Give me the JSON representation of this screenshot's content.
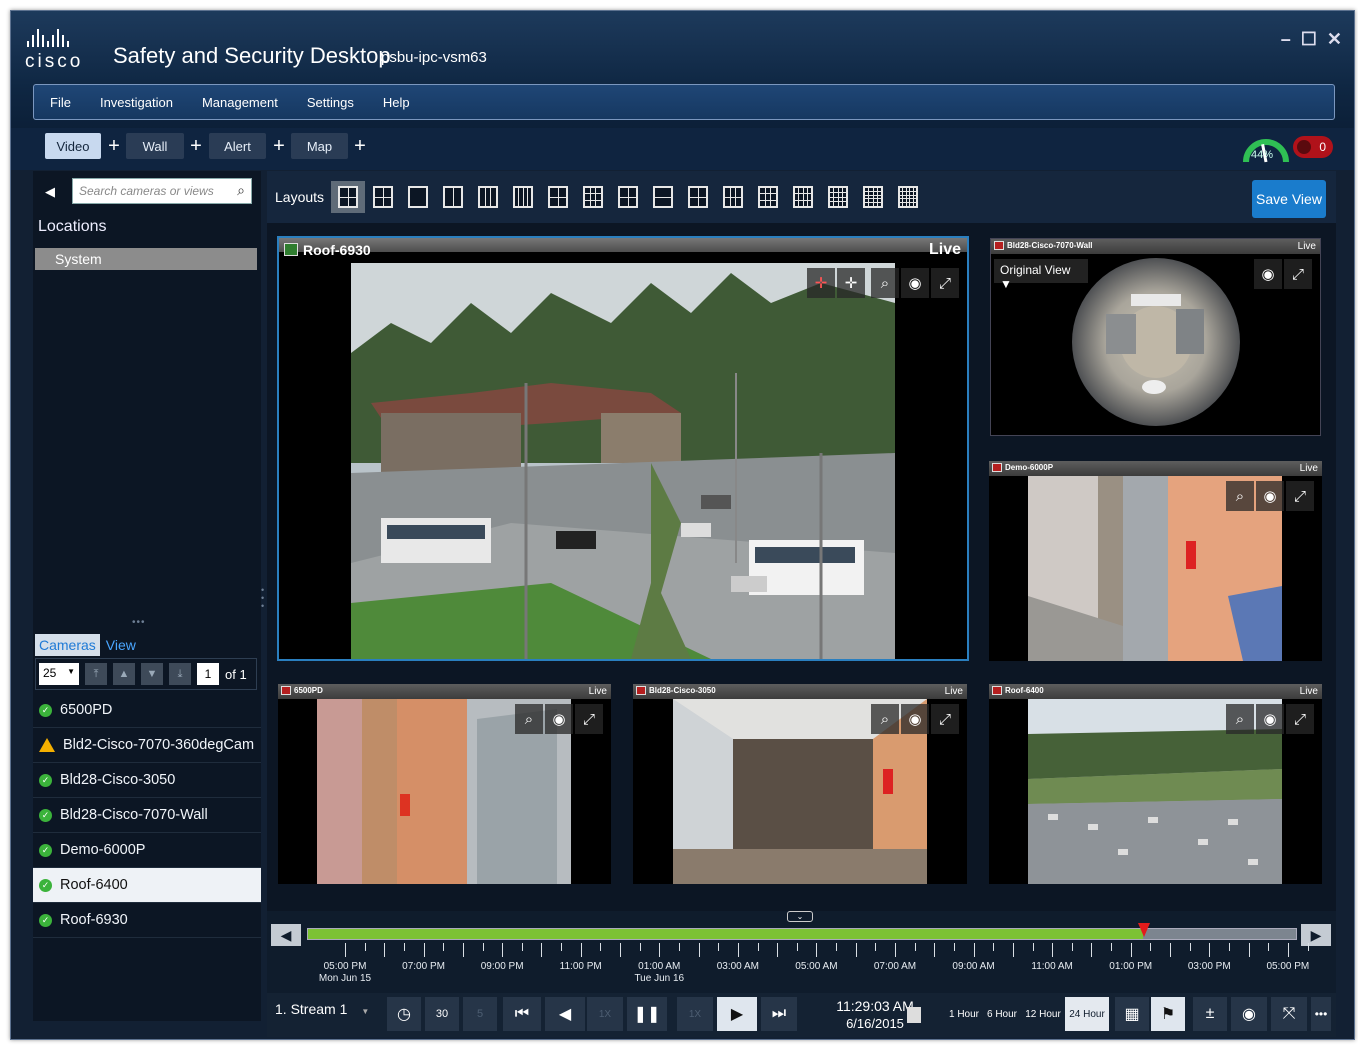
{
  "window": {
    "logo_text": "cisco",
    "title": "Safety and Security Desktop",
    "host": "psbu-ipc-vsm63",
    "minimize": "–",
    "maximize": "☐",
    "close": "✕"
  },
  "menu": [
    "File",
    "Investigation",
    "Management",
    "Settings",
    "Help"
  ],
  "tabs": [
    {
      "label": "Video",
      "active": true
    },
    {
      "label": "Wall",
      "active": false
    },
    {
      "label": "Alert",
      "active": false
    },
    {
      "label": "Map",
      "active": false
    }
  ],
  "tab_add": "+",
  "status": {
    "health_percent": "44%",
    "health_value": 44,
    "alarm_count": "0",
    "alarm_color": "#b0121a",
    "gauge_color": "#2fbf54"
  },
  "sidebar": {
    "back_icon": "◀",
    "search_placeholder": "Search cameras or views",
    "locations_label": "Locations",
    "system_label": "System",
    "tabs": [
      "Cameras",
      "View"
    ],
    "page_size": "25",
    "page_current": "1",
    "page_of": "of 1",
    "cameras": [
      {
        "name": "6500PD",
        "status": "ok"
      },
      {
        "name": "Bld2-Cisco-7070-360degCam",
        "status": "warning"
      },
      {
        "name": "Bld28-Cisco-3050",
        "status": "ok"
      },
      {
        "name": "Bld28-Cisco-7070-Wall",
        "status": "ok"
      },
      {
        "name": "Demo-6000P",
        "status": "ok"
      },
      {
        "name": "Roof-6400",
        "status": "ok",
        "selected": true
      },
      {
        "name": "Roof-6930",
        "status": "ok"
      }
    ]
  },
  "layouts": {
    "label": "Layouts",
    "save_view": "Save View"
  },
  "tiles": {
    "big": {
      "name": "Roof-6930",
      "status": "Live"
    },
    "t1": {
      "name": "Bld28-Cisco-7070-Wall",
      "status": "Live",
      "view_mode": "Original View ▼"
    },
    "t2": {
      "name": "Demo-6000P",
      "status": "Live"
    },
    "t3": {
      "name": "6500PD",
      "status": "Live"
    },
    "t4": {
      "name": "Bld28-Cisco-3050",
      "status": "Live"
    },
    "t5": {
      "name": "Roof-6400",
      "status": "Live"
    }
  },
  "timeline": {
    "progress": 0.845,
    "labels": [
      {
        "time": "05:00 PM",
        "date": "Mon Jun 15"
      },
      {
        "time": "07:00 PM",
        "date": ""
      },
      {
        "time": "09:00 PM",
        "date": ""
      },
      {
        "time": "11:00 PM",
        "date": ""
      },
      {
        "time": "01:00 AM",
        "date": "Tue Jun 16"
      },
      {
        "time": "03:00 AM",
        "date": ""
      },
      {
        "time": "05:00 AM",
        "date": ""
      },
      {
        "time": "07:00 AM",
        "date": ""
      },
      {
        "time": "09:00 AM",
        "date": ""
      },
      {
        "time": "11:00 AM",
        "date": ""
      },
      {
        "time": "01:00 PM",
        "date": ""
      },
      {
        "time": "03:00 PM",
        "date": ""
      },
      {
        "time": "05:00 PM",
        "date": ""
      }
    ],
    "stream": "1. Stream 1",
    "speed1": "1X",
    "speed2": "1X",
    "current_time": "11:29:03 AM",
    "current_date": "6/16/2015",
    "ranges": [
      "1 Hour",
      "6 Hour",
      "12 Hour",
      "24 Hour"
    ],
    "active_range": "24 Hour",
    "skip_back": "30",
    "skip_fwd": "5"
  }
}
